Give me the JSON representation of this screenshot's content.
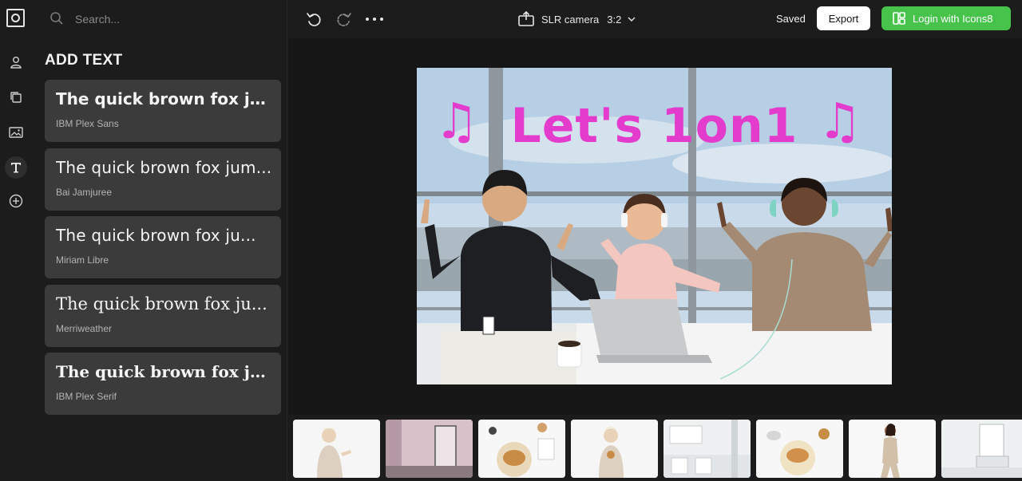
{
  "app": {
    "search_placeholder": "Search...",
    "camera_label": "SLR camera",
    "aspect_ratio": "3:2",
    "save_status": "Saved",
    "export_label": "Export",
    "login_label": "Login with Icons8",
    "accent_color": "#47c34b"
  },
  "rail": {
    "items": [
      "person-icon",
      "layers-icon",
      "image-icon",
      "text-icon",
      "add-icon"
    ],
    "active": "text-icon"
  },
  "sidebar": {
    "title": "ADD TEXT",
    "fonts": [
      {
        "sample": "The quick brown fox ju...",
        "name": "IBM Plex Sans"
      },
      {
        "sample": "The quick brown fox jum...",
        "name": "Bai Jamjuree"
      },
      {
        "sample": "The quick brown fox ju...",
        "name": "Miriam Libre"
      },
      {
        "sample": "The quick brown fox ju...",
        "name": "Merriweather"
      },
      {
        "sample": "The quick brown fox ju...",
        "name": "IBM Plex Serif"
      }
    ]
  },
  "canvas": {
    "headline": "Let's 1on1",
    "note_glyph": "♫",
    "text_color": "#e33bcc"
  },
  "thumbnails": [
    "woman-pointing",
    "pink-room",
    "pastries-top",
    "woman-eating",
    "white-kitchen",
    "croissant-plate",
    "woman-dancing",
    "bathroom"
  ]
}
